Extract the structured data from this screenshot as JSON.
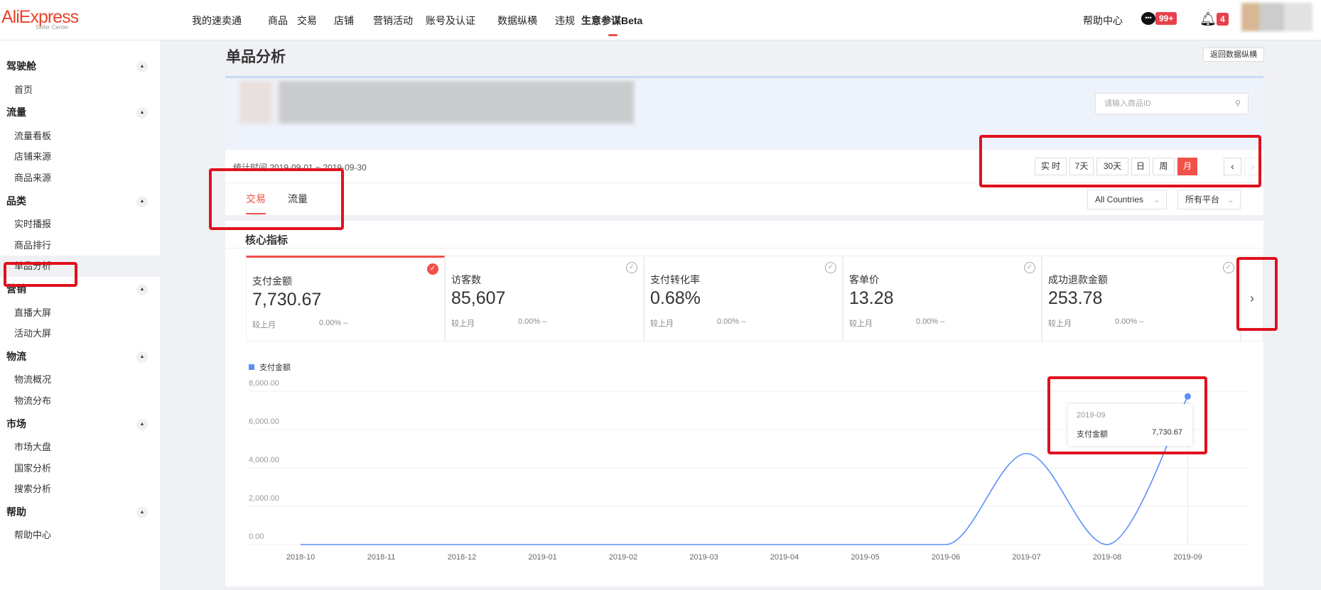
{
  "header": {
    "logo": "AliExpress",
    "logo_sub": "Seller Center",
    "nav": [
      "我的速卖通",
      "商品",
      "交易",
      "店铺",
      "营销活动",
      "账号及认证",
      "数据纵横",
      "违规",
      "生意参谋Beta"
    ],
    "help": "帮助中心",
    "messages_badge": "99+",
    "notifications_badge": "4"
  },
  "sidebar": [
    {
      "group": "驾驶舱",
      "items": [
        "首页"
      ]
    },
    {
      "group": "流量",
      "items": [
        "流量看板",
        "店铺来源",
        "商品来源"
      ]
    },
    {
      "group": "品类",
      "items": [
        "实时播报",
        "商品排行",
        "单品分析"
      ]
    },
    {
      "group": "营销",
      "items": [
        "直播大屏",
        "活动大屏"
      ]
    },
    {
      "group": "物流",
      "items": [
        "物流概况",
        "物流分布"
      ]
    },
    {
      "group": "市场",
      "items": [
        "市场大盘",
        "国家分析",
        "搜索分析"
      ]
    },
    {
      "group": "帮助",
      "items": [
        "帮助中心"
      ]
    }
  ],
  "page": {
    "title": "单品分析",
    "back_button": "返回数据纵横",
    "search_placeholder": "请输入商品ID",
    "period": "统计时间 2019-09-01 ~ 2019-09-30",
    "time_buttons": [
      "实 时",
      "7天",
      "30天",
      "日",
      "周",
      "月"
    ],
    "tabs": [
      "交易",
      "流量"
    ],
    "country": "All Countries",
    "platform": "所有平台",
    "section_title": "核心指标"
  },
  "metrics": [
    {
      "label": "支付金额",
      "value": "7,730.67",
      "compare": "较上月",
      "change": "0.00%  –",
      "selected": true
    },
    {
      "label": "访客数",
      "value": "85,607",
      "compare": "较上月",
      "change": "0.00%  –",
      "selected": false
    },
    {
      "label": "支付转化率",
      "value": "0.68%",
      "compare": "较上月",
      "change": "0.00%  –",
      "selected": false
    },
    {
      "label": "客单价",
      "value": "13.28",
      "compare": "较上月",
      "change": "0.00%  –",
      "selected": false
    },
    {
      "label": "成功退款金额",
      "value": "253.78",
      "compare": "较上月",
      "change": "0.00%  –",
      "selected": false
    }
  ],
  "chart_data": {
    "type": "line",
    "legend": [
      "支付金额"
    ],
    "series_color": "#5b8ff9",
    "x": [
      "2018-10",
      "2018-11",
      "2018-12",
      "2019-01",
      "2019-02",
      "2019-03",
      "2019-04",
      "2019-05",
      "2019-06",
      "2019-07",
      "2019-08",
      "2019-09"
    ],
    "series": [
      {
        "name": "支付金额",
        "values": [
          0,
          0,
          0,
          0,
          0,
          0,
          0,
          0,
          0,
          4750,
          0,
          7730.67
        ]
      }
    ],
    "yticks": [
      "0.00",
      "2,000.00",
      "4,000.00",
      "6,000.00",
      "8,000.00"
    ],
    "ylim": [
      0,
      8000
    ],
    "tooltip": {
      "title": "2019-09",
      "label": "支付金额",
      "value": "7,730.67"
    }
  }
}
